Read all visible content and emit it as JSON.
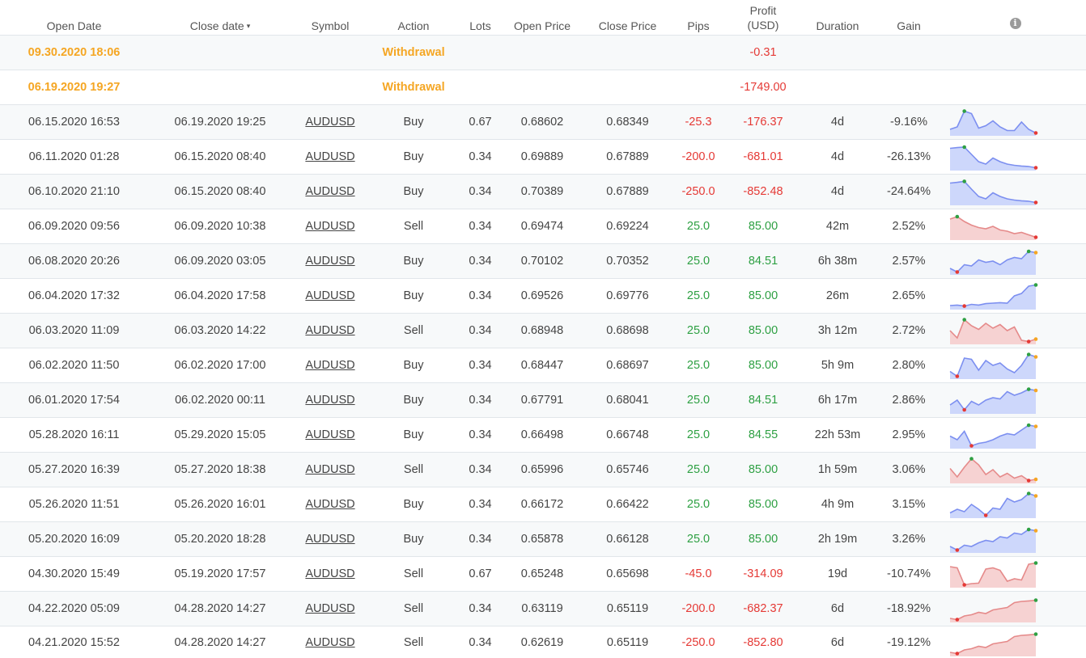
{
  "headers": {
    "open_date": "Open Date",
    "close_date": "Close date",
    "sort_indicator": "▾",
    "symbol": "Symbol",
    "action": "Action",
    "lots": "Lots",
    "open_price": "Open Price",
    "close_price": "Close Price",
    "pips": "Pips",
    "profit_line1": "Profit",
    "profit_line2": "(USD)",
    "duration": "Duration",
    "gain": "Gain",
    "info_icon": "i"
  },
  "colors": {
    "withdrawal": "#f5a623",
    "negative": "#e53935",
    "positive": "#2ea043",
    "spark_buy_line": "#7c8ff0",
    "spark_buy_fill": "#cdd7fb",
    "spark_sell_line": "#e58a8a",
    "spark_sell_fill": "#f6d2d2",
    "spark_max": "#2ea043",
    "spark_min": "#e53935",
    "spark_end": "#f5a623"
  },
  "rows": [
    {
      "open_date": "09.30.2020 18:06",
      "close_date": "",
      "symbol": "",
      "action": "Withdrawal",
      "lots": "",
      "open_price": "",
      "close_price": "",
      "pips": "",
      "profit": "-0.31",
      "duration": "",
      "gain": "",
      "withdrawal": true
    },
    {
      "open_date": "06.19.2020 19:27",
      "close_date": "",
      "symbol": "",
      "action": "Withdrawal",
      "lots": "",
      "open_price": "",
      "close_price": "",
      "pips": "",
      "profit": "-1749.00",
      "duration": "",
      "gain": "",
      "withdrawal": true
    },
    {
      "open_date": "06.15.2020 16:53",
      "close_date": "06.19.2020 19:25",
      "symbol": "AUDUSD",
      "action": "Buy",
      "lots": "0.67",
      "open_price": "0.68602",
      "close_price": "0.68349",
      "pips": "-25.3",
      "profit": "-176.37",
      "duration": "4d",
      "gain": "-9.16%",
      "spark": [
        0.2,
        0.3,
        0.95,
        0.85,
        0.25,
        0.35,
        0.55,
        0.3,
        0.15,
        0.15,
        0.5,
        0.2,
        0.05
      ]
    },
    {
      "open_date": "06.11.2020 01:28",
      "close_date": "06.15.2020 08:40",
      "symbol": "AUDUSD",
      "action": "Buy",
      "lots": "0.34",
      "open_price": "0.69889",
      "close_price": "0.67889",
      "pips": "-200.0",
      "profit": "-681.01",
      "duration": "4d",
      "gain": "-26.13%",
      "spark": [
        0.85,
        0.88,
        0.9,
        0.6,
        0.3,
        0.2,
        0.45,
        0.3,
        0.2,
        0.15,
        0.12,
        0.1,
        0.05
      ]
    },
    {
      "open_date": "06.10.2020 21:10",
      "close_date": "06.15.2020 08:40",
      "symbol": "AUDUSD",
      "action": "Buy",
      "lots": "0.34",
      "open_price": "0.70389",
      "close_price": "0.67889",
      "pips": "-250.0",
      "profit": "-852.48",
      "duration": "4d",
      "gain": "-24.64%",
      "spark": [
        0.85,
        0.88,
        0.92,
        0.6,
        0.3,
        0.2,
        0.45,
        0.3,
        0.2,
        0.15,
        0.12,
        0.1,
        0.05
      ]
    },
    {
      "open_date": "06.09.2020 09:56",
      "close_date": "06.09.2020 10:38",
      "symbol": "AUDUSD",
      "action": "Sell",
      "lots": "0.34",
      "open_price": "0.69474",
      "close_price": "0.69224",
      "pips": "25.0",
      "profit": "85.00",
      "duration": "42m",
      "gain": "2.52%",
      "spark": [
        0.8,
        0.9,
        0.7,
        0.55,
        0.45,
        0.4,
        0.5,
        0.35,
        0.3,
        0.2,
        0.25,
        0.15,
        0.05
      ]
    },
    {
      "open_date": "06.08.2020 20:26",
      "close_date": "06.09.2020 03:05",
      "symbol": "AUDUSD",
      "action": "Buy",
      "lots": "0.34",
      "open_price": "0.70102",
      "close_price": "0.70352",
      "pips": "25.0",
      "profit": "84.51",
      "duration": "6h 38m",
      "gain": "2.57%",
      "spark": [
        0.2,
        0.05,
        0.35,
        0.3,
        0.55,
        0.45,
        0.5,
        0.35,
        0.55,
        0.65,
        0.6,
        0.9,
        0.85
      ]
    },
    {
      "open_date": "06.04.2020 17:32",
      "close_date": "06.04.2020 17:58",
      "symbol": "AUDUSD",
      "action": "Buy",
      "lots": "0.34",
      "open_price": "0.69526",
      "close_price": "0.69776",
      "pips": "25.0",
      "profit": "85.00",
      "duration": "26m",
      "gain": "2.65%",
      "spark": [
        0.1,
        0.12,
        0.08,
        0.15,
        0.12,
        0.18,
        0.2,
        0.22,
        0.2,
        0.5,
        0.6,
        0.9,
        0.95
      ]
    },
    {
      "open_date": "06.03.2020 11:09",
      "close_date": "06.03.2020 14:22",
      "symbol": "AUDUSD",
      "action": "Sell",
      "lots": "0.34",
      "open_price": "0.68948",
      "close_price": "0.68698",
      "pips": "25.0",
      "profit": "85.00",
      "duration": "3h 12m",
      "gain": "2.72%",
      "spark": [
        0.5,
        0.2,
        0.95,
        0.7,
        0.55,
        0.8,
        0.6,
        0.75,
        0.5,
        0.65,
        0.1,
        0.05,
        0.15
      ]
    },
    {
      "open_date": "06.02.2020 11:50",
      "close_date": "06.02.2020 17:00",
      "symbol": "AUDUSD",
      "action": "Buy",
      "lots": "0.34",
      "open_price": "0.68447",
      "close_price": "0.68697",
      "pips": "25.0",
      "profit": "85.00",
      "duration": "5h 9m",
      "gain": "2.80%",
      "spark": [
        0.25,
        0.05,
        0.8,
        0.75,
        0.3,
        0.7,
        0.5,
        0.6,
        0.35,
        0.2,
        0.5,
        0.95,
        0.85
      ]
    },
    {
      "open_date": "06.01.2020 17:54",
      "close_date": "06.02.2020 00:11",
      "symbol": "AUDUSD",
      "action": "Buy",
      "lots": "0.34",
      "open_price": "0.67791",
      "close_price": "0.68041",
      "pips": "25.0",
      "profit": "84.51",
      "duration": "6h 17m",
      "gain": "2.86%",
      "spark": [
        0.3,
        0.5,
        0.1,
        0.45,
        0.3,
        0.5,
        0.6,
        0.55,
        0.85,
        0.7,
        0.8,
        0.95,
        0.9
      ]
    },
    {
      "open_date": "05.28.2020 16:11",
      "close_date": "05.29.2020 15:05",
      "symbol": "AUDUSD",
      "action": "Buy",
      "lots": "0.34",
      "open_price": "0.66498",
      "close_price": "0.66748",
      "pips": "25.0",
      "profit": "84.55",
      "duration": "22h 53m",
      "gain": "2.95%",
      "spark": [
        0.45,
        0.3,
        0.65,
        0.05,
        0.15,
        0.2,
        0.3,
        0.45,
        0.55,
        0.5,
        0.7,
        0.9,
        0.85
      ]
    },
    {
      "open_date": "05.27.2020 16:39",
      "close_date": "05.27.2020 18:38",
      "symbol": "AUDUSD",
      "action": "Sell",
      "lots": "0.34",
      "open_price": "0.65996",
      "close_price": "0.65746",
      "pips": "25.0",
      "profit": "85.00",
      "duration": "1h 59m",
      "gain": "3.06%",
      "spark": [
        0.55,
        0.2,
        0.6,
        0.95,
        0.7,
        0.3,
        0.5,
        0.2,
        0.35,
        0.15,
        0.25,
        0.05,
        0.1
      ]
    },
    {
      "open_date": "05.26.2020 11:51",
      "close_date": "05.26.2020 16:01",
      "symbol": "AUDUSD",
      "action": "Buy",
      "lots": "0.34",
      "open_price": "0.66172",
      "close_price": "0.66422",
      "pips": "25.0",
      "profit": "85.00",
      "duration": "4h 9m",
      "gain": "3.15%",
      "spark": [
        0.15,
        0.3,
        0.2,
        0.5,
        0.3,
        0.05,
        0.35,
        0.3,
        0.75,
        0.6,
        0.7,
        0.95,
        0.85
      ]
    },
    {
      "open_date": "05.20.2020 16:09",
      "close_date": "05.20.2020 18:28",
      "symbol": "AUDUSD",
      "action": "Buy",
      "lots": "0.34",
      "open_price": "0.65878",
      "close_price": "0.66128",
      "pips": "25.0",
      "profit": "85.00",
      "duration": "2h 19m",
      "gain": "3.26%",
      "spark": [
        0.2,
        0.05,
        0.25,
        0.2,
        0.35,
        0.45,
        0.4,
        0.6,
        0.55,
        0.75,
        0.7,
        0.9,
        0.85
      ]
    },
    {
      "open_date": "04.30.2020 15:49",
      "close_date": "05.19.2020 17:57",
      "symbol": "AUDUSD",
      "action": "Sell",
      "lots": "0.67",
      "open_price": "0.65248",
      "close_price": "0.65698",
      "pips": "-45.0",
      "profit": "-314.09",
      "duration": "19d",
      "gain": "-10.74%",
      "spark": [
        0.8,
        0.75,
        0.05,
        0.1,
        0.12,
        0.7,
        0.75,
        0.65,
        0.2,
        0.3,
        0.25,
        0.9,
        0.95
      ]
    },
    {
      "open_date": "04.22.2020 05:09",
      "close_date": "04.28.2020 14:27",
      "symbol": "AUDUSD",
      "action": "Sell",
      "lots": "0.34",
      "open_price": "0.63119",
      "close_price": "0.65119",
      "pips": "-200.0",
      "profit": "-682.37",
      "duration": "6d",
      "gain": "-18.92%",
      "spark": [
        0.1,
        0.05,
        0.2,
        0.25,
        0.35,
        0.3,
        0.45,
        0.5,
        0.55,
        0.75,
        0.8,
        0.82,
        0.85
      ]
    },
    {
      "open_date": "04.21.2020 15:52",
      "close_date": "04.28.2020 14:27",
      "symbol": "AUDUSD",
      "action": "Sell",
      "lots": "0.34",
      "open_price": "0.62619",
      "close_price": "0.65119",
      "pips": "-250.0",
      "profit": "-852.80",
      "duration": "6d",
      "gain": "-19.12%",
      "spark": [
        0.1,
        0.05,
        0.2,
        0.25,
        0.35,
        0.3,
        0.45,
        0.5,
        0.55,
        0.75,
        0.8,
        0.82,
        0.85
      ]
    }
  ]
}
